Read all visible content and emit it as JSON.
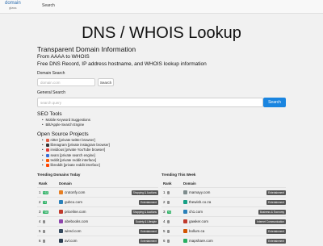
{
  "header": {
    "logo_main": "domain",
    "logo_sub": "glass",
    "nav_search": "Search"
  },
  "page_title": "DNS / WHOIS Lookup",
  "subtitle": "Transparent Domain Information",
  "tagline": "From AAAA to WHOIS",
  "description": "Free DNS Record, IP address hostname, and WHOIS lookup information",
  "domain_search": {
    "label": "Domain Search",
    "placeholder": "domain.com",
    "button": "Search"
  },
  "general_search": {
    "label": "General Search",
    "placeholder": "search query",
    "button": "Search"
  },
  "seo_tools": {
    "title": "SEO Tools",
    "items": [
      "Mobile Keyword Suggestions",
      "Bilt/Apple-Search Engine"
    ]
  },
  "open_source": {
    "title": "Open Source Projects",
    "items": [
      {
        "label": "nitter [private twitter browser]",
        "color": "#e05d44"
      },
      {
        "label": "libreagram [private instagram browser]",
        "color": "#333333"
      },
      {
        "label": "invidious [private YouTube browser]",
        "color": "#e53935"
      },
      {
        "label": "searx [private search engine]",
        "color": "#3a6fd8"
      },
      {
        "label": "teddit [private reddit interface]",
        "color": "#ff5700"
      },
      {
        "label": "libreddit [private reddit interface]",
        "color": "#ff4500"
      }
    ]
  },
  "trending_today": {
    "title": "Trending Domains Today",
    "col_rank": "Rank",
    "col_domain": "Domain",
    "rows": [
      {
        "rank": "1",
        "change": "+33",
        "change_color": "#27ae60",
        "domain": "crutonfy.com",
        "category": "Shopping & Auctions",
        "fav": "#e67e22"
      },
      {
        "rank": "2",
        "change": "+3",
        "change_color": "#27ae60",
        "domain": "gubco.com",
        "category": "Entertainment",
        "fav": "#2980b9"
      },
      {
        "rank": "3",
        "change": "+28",
        "change_color": "#27ae60",
        "domain": "priceline.com",
        "category": "Shopping & Auctions",
        "fav": "#c0392b"
      },
      {
        "rank": "4",
        "change": "-",
        "change_color": "#888888",
        "domain": "abebooks.com",
        "category": "Society & Lifestyle",
        "fav": "#8e44ad"
      },
      {
        "rank": "5",
        "change": "-",
        "change_color": "#888888",
        "domain": "wired.com",
        "category": "Entertainment",
        "fav": "#34495e"
      },
      {
        "rank": "6",
        "change": "-",
        "change_color": "#888888",
        "domain": "avl.com",
        "category": "Entertainment",
        "fav": "#2c3e50"
      }
    ]
  },
  "trending_week": {
    "title": "Trending This Week",
    "col_rank": "Rank",
    "col_domain": "Domain",
    "rows": [
      {
        "rank": "1",
        "change": "-",
        "change_color": "#888888",
        "domain": "mamayy.com",
        "category": "Entertainment",
        "fav": "#7f8c8d"
      },
      {
        "rank": "2",
        "change": "-",
        "change_color": "#888888",
        "domain": "thewish.co.za",
        "category": "Entertainment",
        "fav": "#16a085"
      },
      {
        "rank": "3",
        "change": "+3",
        "change_color": "#27ae60",
        "domain": "ch1.com",
        "category": "Business & Economy",
        "fav": "#2980b9"
      },
      {
        "rank": "4",
        "change": "-",
        "change_color": "#888888",
        "domain": "gawker.com",
        "category": "Internet Communication",
        "fav": "#c0392b"
      },
      {
        "rank": "5",
        "change": "-",
        "change_color": "#888888",
        "domain": "bollum.ca",
        "category": "Entertainment",
        "fav": "#d35400"
      },
      {
        "rank": "6",
        "change": "-",
        "change_color": "#888888",
        "domain": "mapshare.com",
        "category": "Entertainment",
        "fav": "#27ae60"
      }
    ]
  }
}
